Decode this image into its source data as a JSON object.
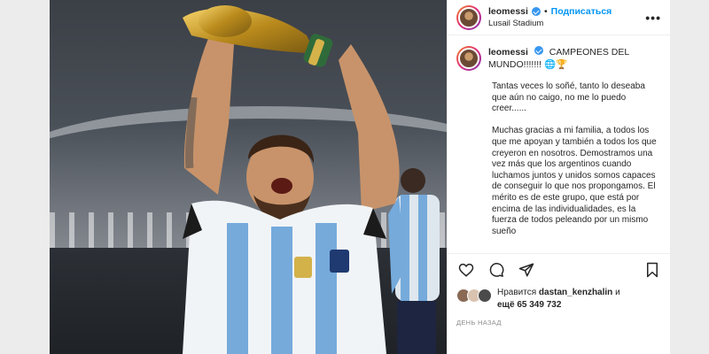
{
  "post": {
    "username": "leomessi",
    "follow_label": "Подписаться",
    "separator": "•",
    "location": "Lusail Stadium",
    "more_label": "•••",
    "caption_first_line": "CAMPEONES DEL MUNDO!!!!!!! 🌐🏆",
    "caption_paragraphs": [
      "Tantas veces lo soñé, tanto lo deseaba que aún no caigo, no me lo puedo creer......",
      "Muchas gracias a mi familia, a todos los que me apoyan y también a todos los que creyeron en nosotros. Demostramos una vez más que los argentinos cuando luchamos juntos y unidos somos capaces de conseguir lo que nos propongamos. El mérito es de este grupo, que está por encima de las individualidades, es la fuerza de todos peleando por un mismo sueño"
    ],
    "likes_prefix": "Нравится",
    "likes_user": "dastan_kenzhalin",
    "likes_suffix": "и",
    "likes_more": "ещё 65 349 732",
    "date": "ДЕНЬ НАЗАД"
  },
  "icons": [
    "verified-badge-icon",
    "next-arrow-icon",
    "heart-icon",
    "comment-icon",
    "share-icon",
    "bookmark-icon",
    "more-options-icon"
  ],
  "colors": {
    "accent_blue": "#0095f6",
    "verified_blue": "#3897f0",
    "text": "#262626",
    "muted": "#8e8e8e",
    "argentina_sky": "#75aadb"
  }
}
